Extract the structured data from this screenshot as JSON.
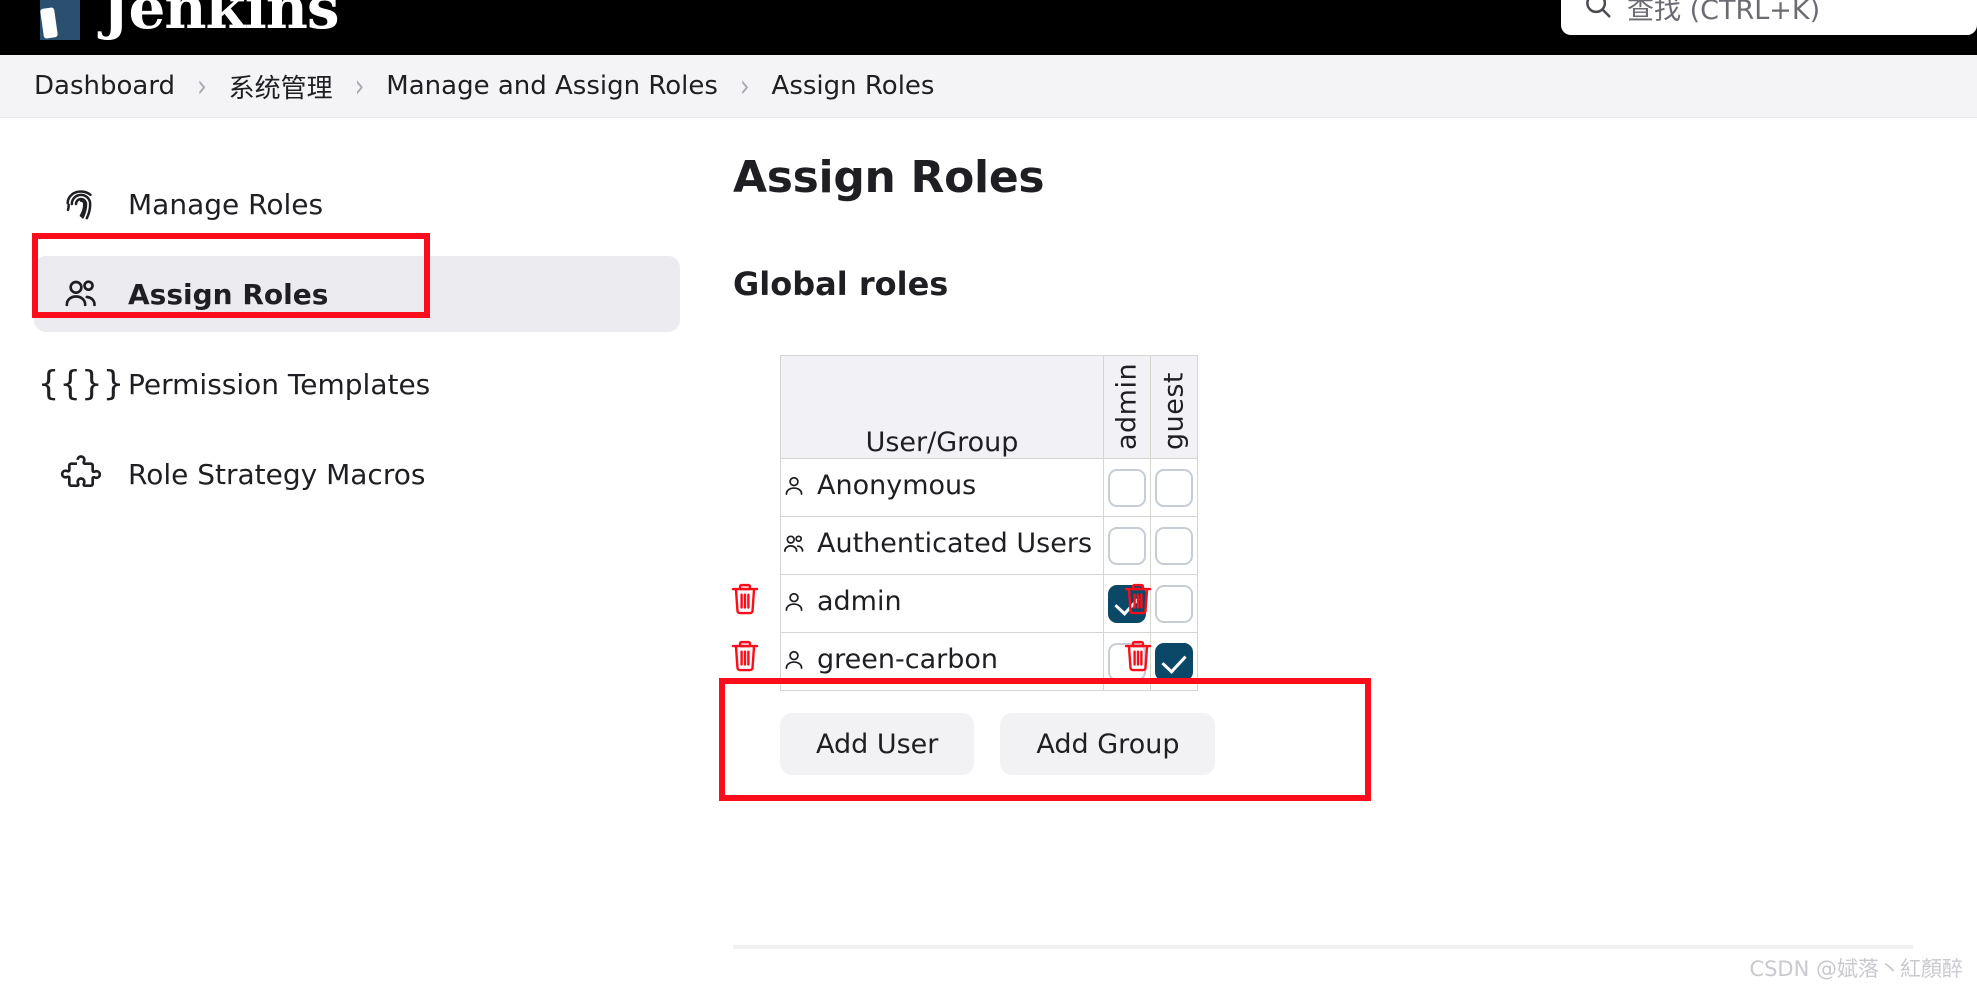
{
  "header": {
    "brand": "Jenkins",
    "brand_logo_icon": "jenkins-butler-logo",
    "search": {
      "icon": "search-icon",
      "placeholder": "查找 (CTRL+K)",
      "value": ""
    }
  },
  "breadcrumb": {
    "separator": "›",
    "items": [
      "Dashboard",
      "系统管理",
      "Manage and Assign Roles",
      "Assign Roles"
    ]
  },
  "sidebar": {
    "items": [
      {
        "label": "Manage Roles",
        "icon": "fingerprint-icon",
        "active": false
      },
      {
        "label": "Assign Roles",
        "icon": "people-icon",
        "active": true
      },
      {
        "label": "Permission Templates",
        "icon": "braces-icon",
        "glyph": "{{}}",
        "active": false
      },
      {
        "label": "Role Strategy Macros",
        "icon": "puzzle-piece-icon",
        "active": false
      }
    ]
  },
  "main": {
    "page_title": "Assign Roles",
    "section_title": "Global roles",
    "table": {
      "name_column_header": "User/Group",
      "role_columns": [
        "admin",
        "guest"
      ],
      "rows": [
        {
          "name": "Anonymous",
          "icon": "user-icon",
          "deletable": false,
          "checks": [
            false,
            false
          ]
        },
        {
          "name": "Authenticated Users",
          "icon": "users-icon",
          "deletable": false,
          "checks": [
            false,
            false
          ]
        },
        {
          "name": "admin",
          "icon": "user-icon",
          "deletable": true,
          "checks": [
            true,
            false
          ]
        },
        {
          "name": "green-carbon",
          "icon": "user-icon",
          "deletable": true,
          "checks": [
            false,
            true
          ]
        }
      ],
      "delete_icon": "trash-icon"
    },
    "buttons": {
      "add_user": "Add User",
      "add_group": "Add Group"
    }
  },
  "annotations": {
    "highlight_color": "#fc0d1b",
    "boxes": [
      "sidebar-assign-roles",
      "table-green-carbon-row"
    ]
  },
  "watermark": "CSDN @娬落丶紅顏醉",
  "colors": {
    "header_background": "#000000",
    "breadcrumb_background": "#f4f4f7",
    "checkbox_checked": "#0b4868",
    "checkbox_border": "#c6cdd4",
    "sidebar_active_background": "#ebebf0",
    "button_background": "#f2f2f5"
  }
}
